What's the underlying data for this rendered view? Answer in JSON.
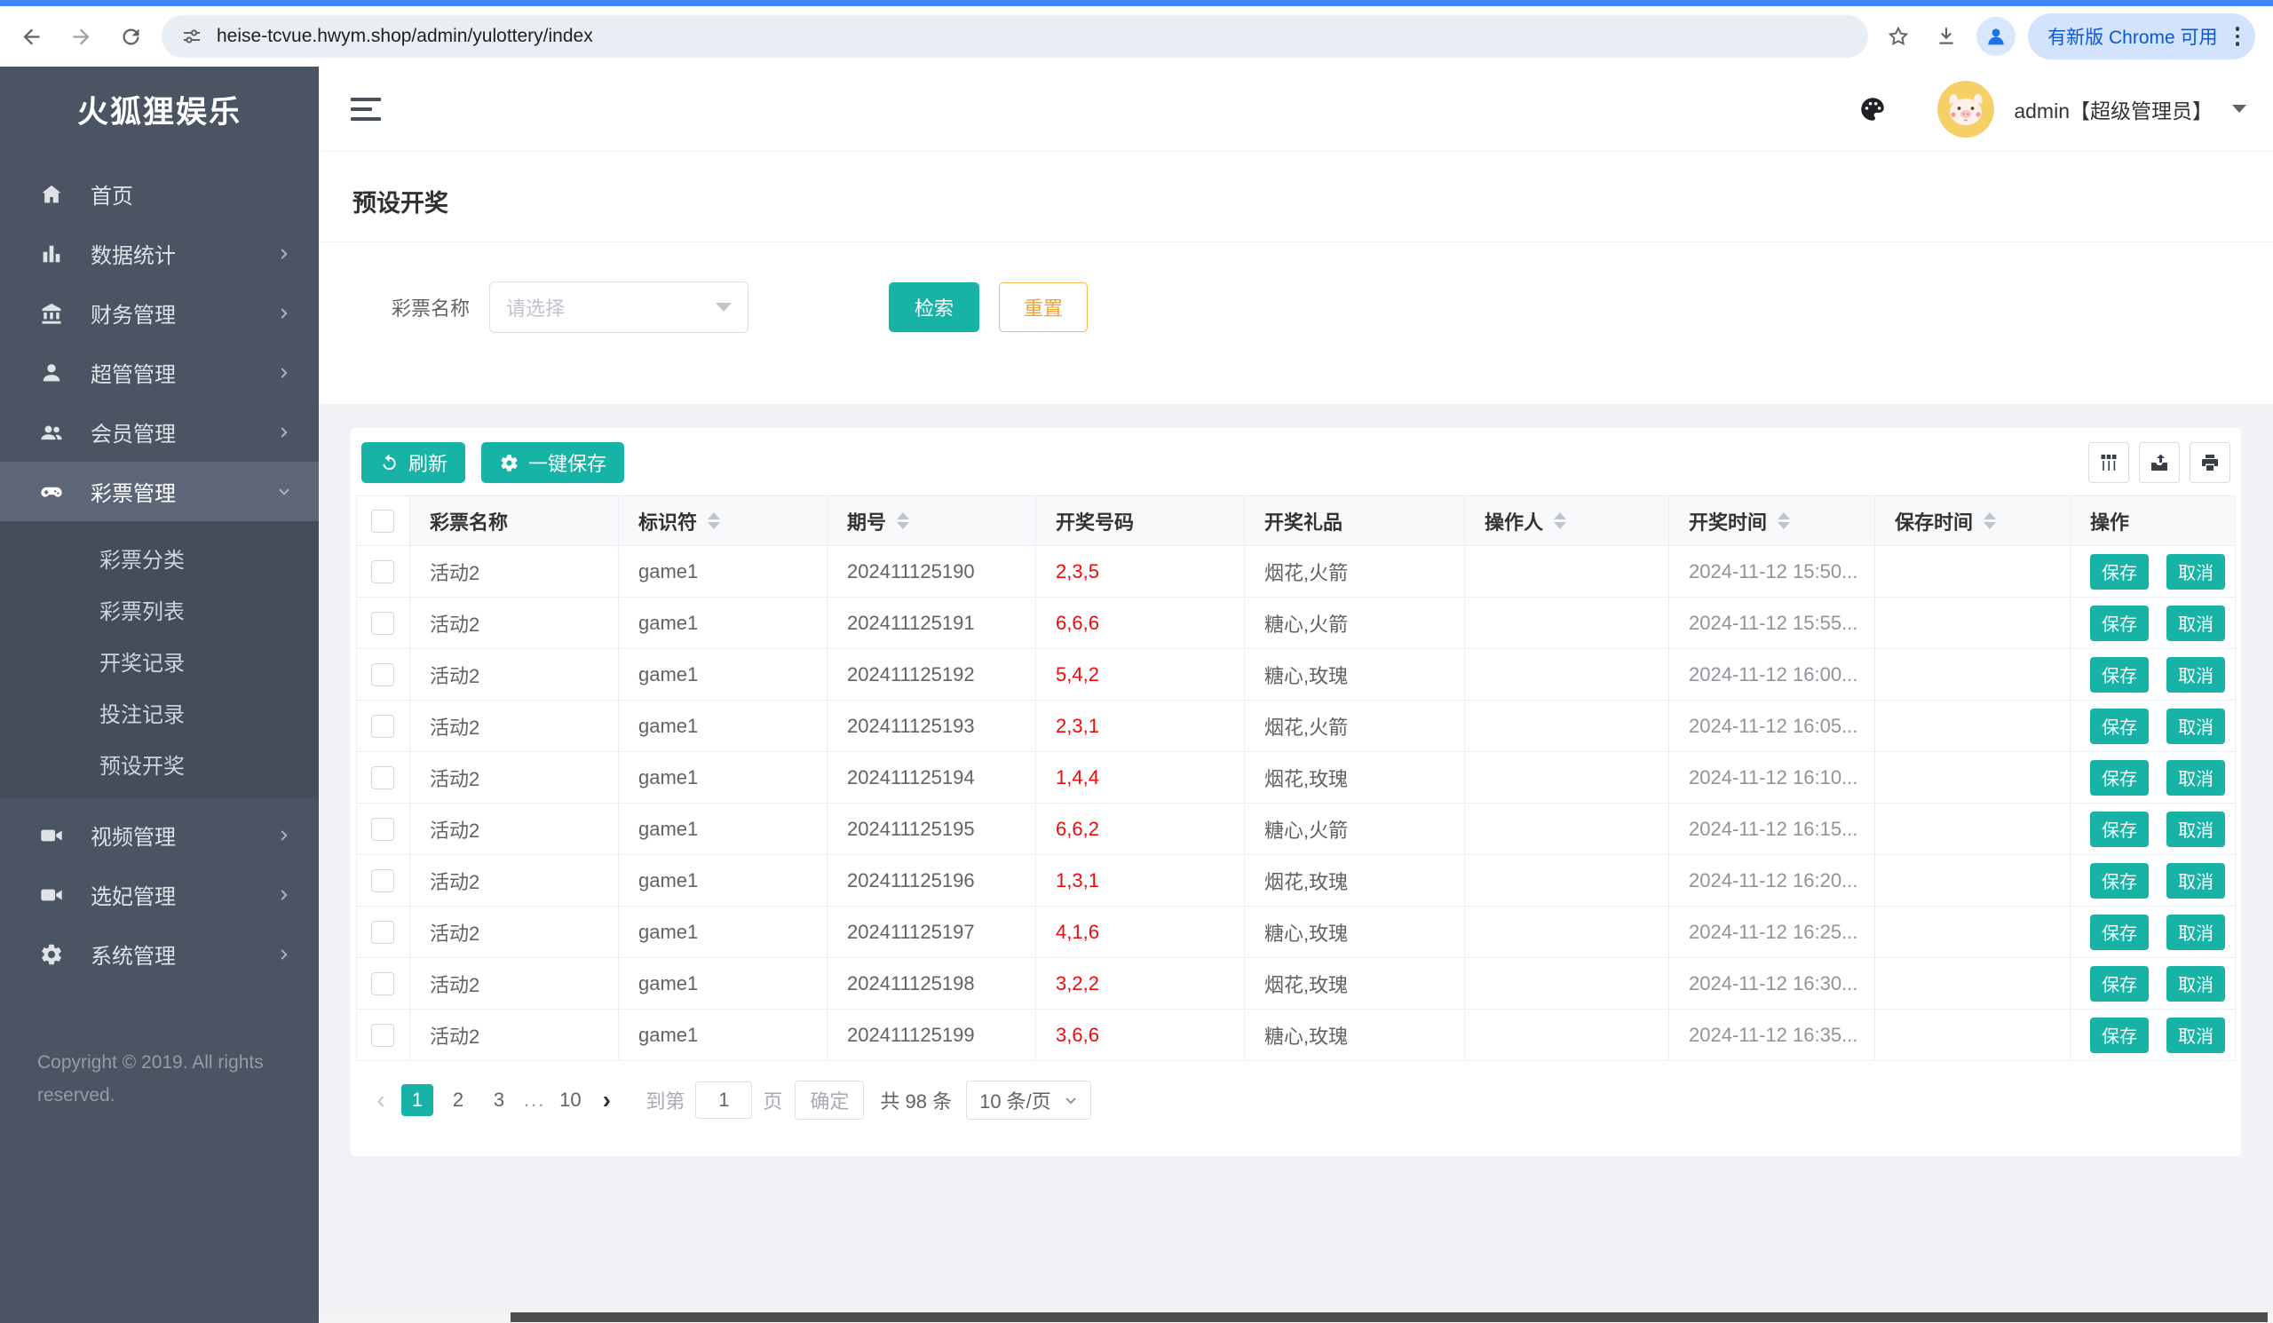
{
  "browser": {
    "url": "heise-tcvue.hwym.shop/admin/yulottery/index",
    "update_badge": "有新版 Chrome 可用"
  },
  "sidebar": {
    "logo": "火狐狸娱乐",
    "items": [
      {
        "label": "首页"
      },
      {
        "label": "数据统计"
      },
      {
        "label": "财务管理"
      },
      {
        "label": "超管管理"
      },
      {
        "label": "会员管理"
      },
      {
        "label": "彩票管理"
      },
      {
        "label": "视频管理"
      },
      {
        "label": "选妃管理"
      },
      {
        "label": "系统管理"
      }
    ],
    "lottery_submenu": [
      {
        "label": "彩票分类"
      },
      {
        "label": "彩票列表"
      },
      {
        "label": "开奖记录"
      },
      {
        "label": "投注记录"
      },
      {
        "label": "预设开奖"
      }
    ],
    "copyright": "Copyright © 2019. All rights reserved."
  },
  "header": {
    "user": "admin【超级管理员】"
  },
  "page": {
    "title": "预设开奖"
  },
  "filter": {
    "label": "彩票名称",
    "placeholder": "请选择",
    "search_label": "检索",
    "reset_label": "重置"
  },
  "toolbar": {
    "refresh_label": "刷新",
    "save_all_label": "一键保存"
  },
  "table": {
    "headers": [
      {
        "label": "彩票名称",
        "sortable": false
      },
      {
        "label": "标识符",
        "sortable": true
      },
      {
        "label": "期号",
        "sortable": true
      },
      {
        "label": "开奖号码",
        "sortable": false
      },
      {
        "label": "开奖礼品",
        "sortable": false
      },
      {
        "label": "操作人",
        "sortable": true
      },
      {
        "label": "开奖时间",
        "sortable": true
      },
      {
        "label": "保存时间",
        "sortable": true
      },
      {
        "label": "操作",
        "sortable": false
      }
    ],
    "save_label": "保存",
    "cancel_label": "取消",
    "rows": [
      {
        "name": "活动2",
        "code": "game1",
        "issue": "202411125190",
        "numbers": "2,3,5",
        "gift": "烟花,火箭",
        "operator": "",
        "draw_time": "2024-11-12 15:50...",
        "save_time": ""
      },
      {
        "name": "活动2",
        "code": "game1",
        "issue": "202411125191",
        "numbers": "6,6,6",
        "gift": "糖心,火箭",
        "operator": "",
        "draw_time": "2024-11-12 15:55...",
        "save_time": ""
      },
      {
        "name": "活动2",
        "code": "game1",
        "issue": "202411125192",
        "numbers": "5,4,2",
        "gift": "糖心,玫瑰",
        "operator": "",
        "draw_time": "2024-11-12 16:00...",
        "save_time": ""
      },
      {
        "name": "活动2",
        "code": "game1",
        "issue": "202411125193",
        "numbers": "2,3,1",
        "gift": "烟花,火箭",
        "operator": "",
        "draw_time": "2024-11-12 16:05...",
        "save_time": ""
      },
      {
        "name": "活动2",
        "code": "game1",
        "issue": "202411125194",
        "numbers": "1,4,4",
        "gift": "烟花,玫瑰",
        "operator": "",
        "draw_time": "2024-11-12 16:10...",
        "save_time": ""
      },
      {
        "name": "活动2",
        "code": "game1",
        "issue": "202411125195",
        "numbers": "6,6,2",
        "gift": "糖心,火箭",
        "operator": "",
        "draw_time": "2024-11-12 16:15...",
        "save_time": ""
      },
      {
        "name": "活动2",
        "code": "game1",
        "issue": "202411125196",
        "numbers": "1,3,1",
        "gift": "烟花,玫瑰",
        "operator": "",
        "draw_time": "2024-11-12 16:20...",
        "save_time": ""
      },
      {
        "name": "活动2",
        "code": "game1",
        "issue": "202411125197",
        "numbers": "4,1,6",
        "gift": "糖心,玫瑰",
        "operator": "",
        "draw_time": "2024-11-12 16:25...",
        "save_time": ""
      },
      {
        "name": "活动2",
        "code": "game1",
        "issue": "202411125198",
        "numbers": "3,2,2",
        "gift": "烟花,玫瑰",
        "operator": "",
        "draw_time": "2024-11-12 16:30...",
        "save_time": ""
      },
      {
        "name": "活动2",
        "code": "game1",
        "issue": "202411125199",
        "numbers": "3,6,6",
        "gift": "糖心,玫瑰",
        "operator": "",
        "draw_time": "2024-11-12 16:35...",
        "save_time": ""
      }
    ]
  },
  "pagination": {
    "pages": [
      "1",
      "2",
      "3",
      "...",
      "10"
    ],
    "goto_prefix": "到第",
    "goto_value": "1",
    "goto_suffix": "页",
    "confirm_label": "确定",
    "total_label": "共 98 条",
    "page_size": "10 条/页"
  },
  "colors": {
    "accent": "#17b3a6",
    "danger": "#ee0a0a",
    "warning": "#eea236",
    "sidebar_bg": "#4a5462",
    "chrome_badge_bg": "#d3e3fd",
    "chrome_badge_text": "#0b57d0"
  }
}
